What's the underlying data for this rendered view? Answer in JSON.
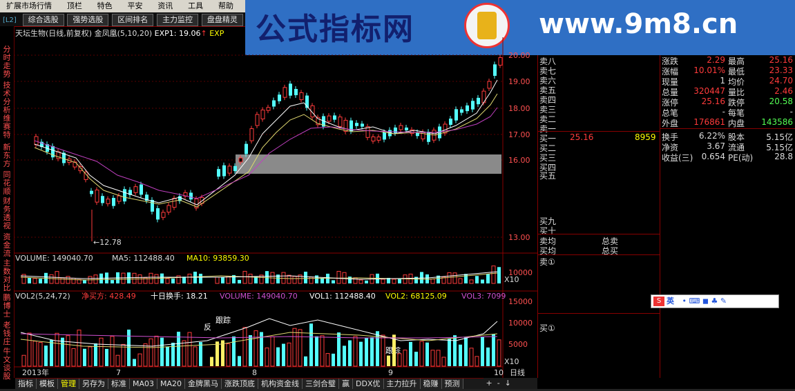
{
  "menu": {
    "items": [
      "扩展市场行情",
      "顶栏",
      "特色",
      "平安",
      "资讯",
      "工具",
      "帮助"
    ]
  },
  "toolbar": {
    "level_tag": "[L2]",
    "tabs": [
      "综合选股",
      "强势选股",
      "区间排名",
      "主力监控",
      "盘盘精灵"
    ]
  },
  "banner": {
    "title": "公式指标网",
    "url": "www.9m8.cn",
    "logo_url": "www.9m8.cn"
  },
  "left_tabs": [
    "分时走势",
    "技术分析",
    "维赛特",
    "新东方",
    "同花顺",
    "财务透视",
    "资金流",
    "主数对比",
    "鹏博士",
    "老钱庄",
    "牛文谈股"
  ],
  "main_chart": {
    "stock_title": "天坛生物(日线,前复权)",
    "indicator": "金凤凰(5,10,20)",
    "exp1": "EXP1: 19.06",
    "exp2": "EXP",
    "price_ticks": [
      "20.00",
      "19.00",
      "18.00",
      "17.00",
      "16.00",
      "13.00"
    ],
    "low_label": "12.78"
  },
  "volume_panel": {
    "volume": "VOLUME: 149040.70",
    "ma5": "MA5: 112488.40",
    "ma10": "MA10: 93859.30",
    "ticks": [
      "10000"
    ],
    "unit": "X10"
  },
  "vol2_panel": {
    "name": "VOL2(5,24,72)",
    "jingmai": "净买方: 428.49",
    "shiri": "十日换手: 18.21",
    "volume": "VOLUME: 149040.70",
    "vol1": "VOL1: 112488.40",
    "vol2": "VOL2: 68125.09",
    "vol3": "VOL3: 7099",
    "ticks": [
      "15000",
      "10000",
      "5000"
    ],
    "unit": "X10",
    "annotations": [
      "反",
      "跟踪",
      "跟踪"
    ]
  },
  "date_axis": {
    "labels": [
      "2013年",
      "7",
      "8",
      "9",
      "10"
    ],
    "mode": "日线"
  },
  "orderbook": {
    "sell_labels": [
      "卖八",
      "卖七",
      "卖六",
      "卖五",
      "卖四",
      "卖三",
      "卖二",
      "卖一"
    ],
    "buy_labels": [
      "买一",
      "买二",
      "买三",
      "买四",
      "买五"
    ],
    "buy1_price": "25.16",
    "buy1_vol": "8959",
    "buy_more": [
      "买九",
      "买十"
    ],
    "avg_sell_label": "卖均",
    "avg_buy_label": "买均",
    "total_sell": "总卖",
    "total_buy": "总买",
    "sell_circle": "卖①",
    "buy_circle": "买①"
  },
  "quote": {
    "rows": [
      {
        "l": "涨跌",
        "v": "2.29",
        "l2": "最高",
        "v2": "25.16"
      },
      {
        "l": "涨幅",
        "v": "10.01%",
        "l2": "最低",
        "v2": "23.33"
      },
      {
        "l": "现量",
        "v": "1",
        "l2": "均价",
        "v2": "24.70"
      },
      {
        "l": "总量",
        "v": "320447",
        "l2": "量比",
        "v2": "2.46"
      },
      {
        "l": "涨停",
        "v": "25.16",
        "l2": "跌停",
        "v2": "20.58"
      },
      {
        "l": "总笔",
        "v": "-",
        "l2": "每笔",
        "v2": "-"
      },
      {
        "l": "外盘",
        "v": "176861",
        "l2": "内盘",
        "v2": "143586"
      },
      {
        "l": "换手",
        "v": "6.22%",
        "l2": "股本",
        "v2": "5.15亿"
      },
      {
        "l": "净资",
        "v": "3.67",
        "l2": "流通",
        "v2": "5.15亿"
      },
      {
        "l": "收益(三)",
        "v": "0.654",
        "l2": "PE(动)",
        "v2": "28.8"
      }
    ]
  },
  "bottom_tabs": [
    "指标",
    "模板",
    "管理",
    "另存为",
    "标准",
    "MA03",
    "MA20",
    "金牌黑马",
    "涨跌顶底",
    "机构资金线",
    "三剑合璧",
    "赢",
    "DDX优",
    "主力拉升",
    "稳赚",
    "预测"
  ],
  "ime": {
    "label": "英"
  },
  "colors": {
    "up": "#ff3b3b",
    "down": "#54ffff",
    "grid": "#8a0000",
    "label": "#ff5050"
  }
}
